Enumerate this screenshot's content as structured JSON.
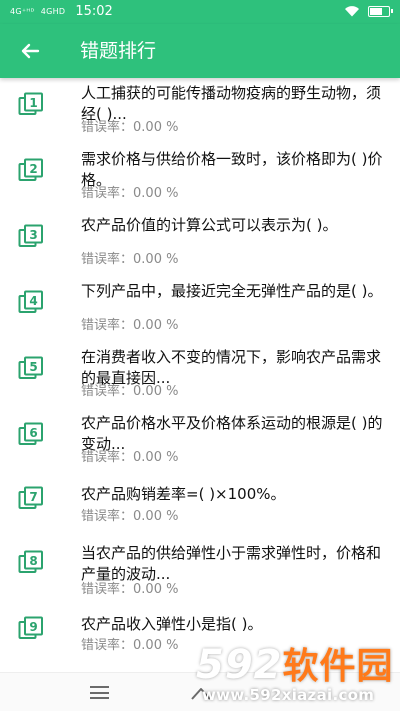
{
  "status_bar": {
    "signal_label_1": "4G⁺ᴴᴰ",
    "signal_label_2": "4GHD",
    "time": "15:02"
  },
  "header": {
    "title": "错题排行",
    "background": "#2ec17c"
  },
  "items": [
    {
      "rank": "1",
      "question": "人工捕获的可能传播动物疫病的野生动物，须经( )...",
      "error_label": "错误率：",
      "error_rate": "0.00 %"
    },
    {
      "rank": "2",
      "question": "需求价格与供给价格一致时，该价格即为( )价格。",
      "error_label": "错误率：",
      "error_rate": "0.00 %"
    },
    {
      "rank": "3",
      "question": "农产品价值的计算公式可以表示为( )。",
      "error_label": "错误率：",
      "error_rate": "0.00 %"
    },
    {
      "rank": "4",
      "question": "下列产品中，最接近完全无弹性产品的是( )。",
      "error_label": "错误率：",
      "error_rate": "0.00 %"
    },
    {
      "rank": "5",
      "question": "在消费者收入不变的情况下，影响农产品需求的最直接因...",
      "error_label": "错误率：",
      "error_rate": "0.00 %"
    },
    {
      "rank": "6",
      "question": "农产品价格水平及价格体系运动的根源是( )的变动...",
      "error_label": "错误率：",
      "error_rate": "0.00 %"
    },
    {
      "rank": "7",
      "question": "农产品购销差率=( )×100%。",
      "error_label": "错误率：",
      "error_rate": "0.00 %"
    },
    {
      "rank": "8",
      "question": "当农产品的供给弹性小于需求弹性时，价格和产量的波动...",
      "error_label": "错误率：",
      "error_rate": "0.00 %"
    },
    {
      "rank": "9",
      "question": "农产品收入弹性小是指( )。",
      "error_label": "错误率：",
      "error_rate": "0.00 %"
    }
  ],
  "watermark": {
    "logo_digits": "592",
    "logo_text": "软件园",
    "url": "www.592xiazai.com"
  },
  "colors": {
    "accent": "#2ec17c",
    "icon": "#2ba36e",
    "question_text": "#111111",
    "error_text": "#8a8a8a"
  },
  "icons": {
    "back": "arrow-left-icon",
    "rank": "stacked-number-card-icon",
    "nav_menu": "menu-icon",
    "nav_home": "home-icon"
  }
}
